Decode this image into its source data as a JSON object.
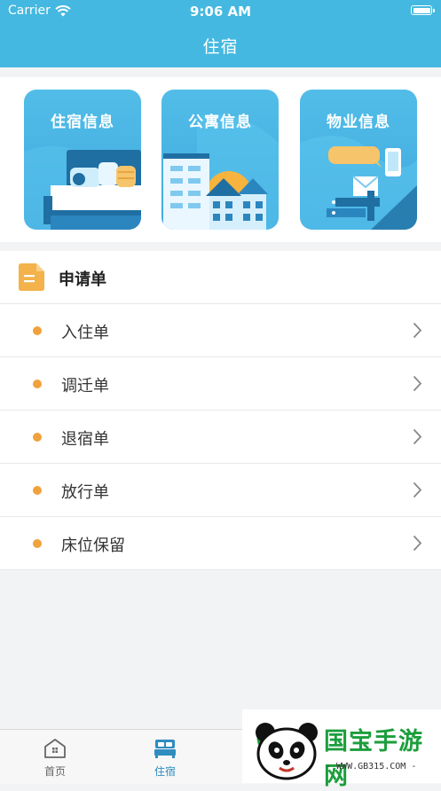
{
  "status_bar": {
    "carrier": "Carrier",
    "time": "9:06 AM"
  },
  "nav": {
    "title": "住宿"
  },
  "cards": [
    {
      "title": "住宿信息"
    },
    {
      "title": "公寓信息"
    },
    {
      "title": "物业信息"
    }
  ],
  "apply": {
    "title": "申请单",
    "items": [
      {
        "label": "入住单"
      },
      {
        "label": "调迁单"
      },
      {
        "label": "退宿单"
      },
      {
        "label": "放行单"
      },
      {
        "label": "床位保留"
      }
    ]
  },
  "tabbar": {
    "tabs": [
      {
        "label": "首页",
        "icon": "home-icon",
        "active": false
      },
      {
        "label": "住宿",
        "icon": "bed-icon",
        "active": true
      }
    ]
  },
  "watermark": {
    "text": "国宝手游网",
    "url": "- WWW.GB315.COM -"
  },
  "colors": {
    "header": "#44b8e0",
    "accent_dot": "#f0a23c",
    "tab_active": "#2f8dc0"
  }
}
